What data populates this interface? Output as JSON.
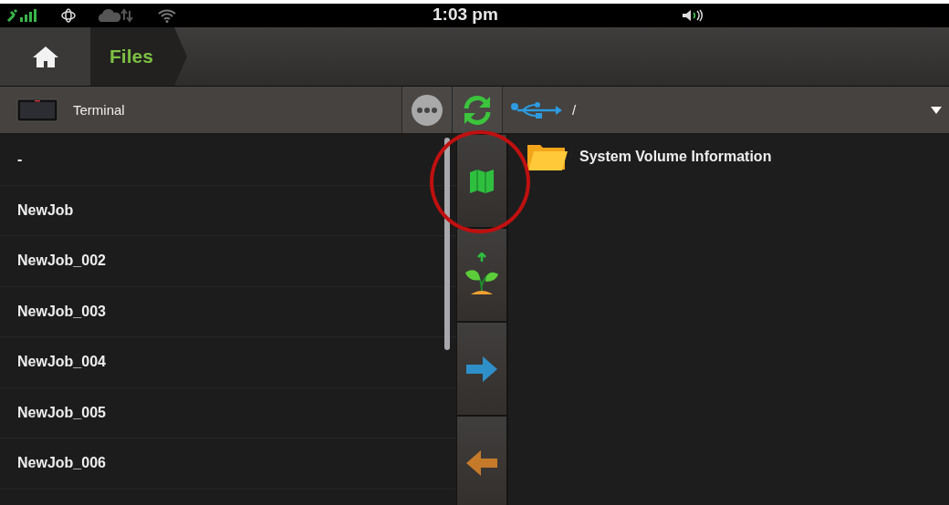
{
  "status_bar": {
    "time": "1:03 pm"
  },
  "breadcrumb": {
    "label": "Files"
  },
  "toolbar": {
    "device": "Terminal",
    "path": "/"
  },
  "jobs": [
    {
      "name": "-"
    },
    {
      "name": "NewJob"
    },
    {
      "name": "NewJob_002"
    },
    {
      "name": "NewJob_003"
    },
    {
      "name": "NewJob_004"
    },
    {
      "name": "NewJob_005"
    },
    {
      "name": "NewJob_006"
    }
  ],
  "files": [
    {
      "name": "System Volume Information"
    }
  ]
}
